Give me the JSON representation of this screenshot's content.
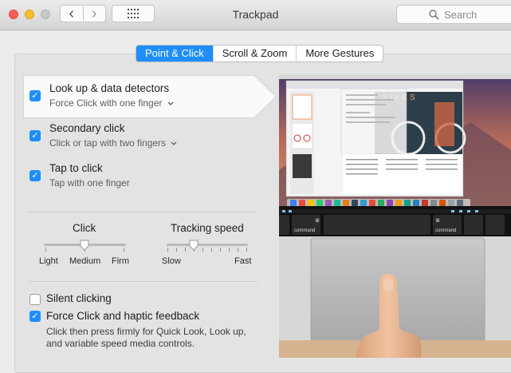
{
  "window": {
    "title": "Trackpad",
    "search_placeholder": "Search",
    "back_glyph": "‹",
    "forward_glyph": "›",
    "grid_glyph": "⋮⋮⋮"
  },
  "tabs": [
    {
      "label": "Point & Click",
      "active": true
    },
    {
      "label": "Scroll & Zoom",
      "active": false
    },
    {
      "label": "More Gestures",
      "active": false
    }
  ],
  "options": [
    {
      "label": "Look up & data detectors",
      "sublabel": "Force Click with one finger",
      "checked": true,
      "dropdown": true
    },
    {
      "label": "Secondary click",
      "sublabel": "Click or tap with two fingers",
      "checked": true,
      "dropdown": true
    },
    {
      "label": "Tap to click",
      "sublabel": "Tap with one finger",
      "checked": true,
      "dropdown": false
    }
  ],
  "click_slider": {
    "title": "Click",
    "labels": [
      "Light",
      "Medium",
      "Firm"
    ],
    "value_index": 1,
    "positions": 3
  },
  "tracking_slider": {
    "title": "Tracking speed",
    "min_label": "Slow",
    "max_label": "Fast",
    "ticks": 10,
    "value_fraction": 0.33
  },
  "silent_clicking": {
    "label": "Silent clicking",
    "checked": false
  },
  "force_click": {
    "label": "Force Click and haptic feedback",
    "checked": true,
    "description_line1": "Click then press firmly for Quick Look, Look up,",
    "description_line2": "and variable speed media controls."
  },
  "preview": {
    "keyboard_left": "command",
    "keyboard_right": "command"
  },
  "colors": {
    "accent": "#1e8efb",
    "close": "#fc5f57",
    "minimize": "#fdbc2e",
    "zoom": "#c8c8c8"
  }
}
